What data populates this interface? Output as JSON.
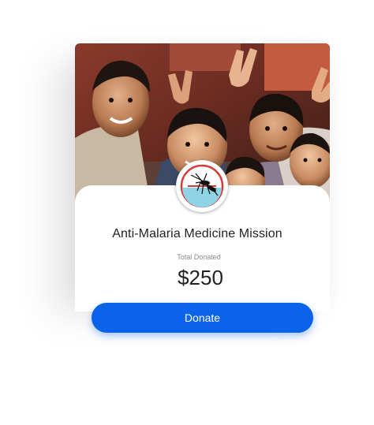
{
  "campaign": {
    "title": "Anti-Malaria Medicine Mission",
    "hero_image": "group-of-smiling-children-photo",
    "badge_icon": "mosquito-icon",
    "total_label": "Total Donated",
    "total_amount": "$250"
  },
  "actions": {
    "donate_label": "Donate"
  },
  "colors": {
    "accent": "#0a63e8",
    "badge_ring": "#d93a3a",
    "badge_fill": "#8fd3e6"
  }
}
